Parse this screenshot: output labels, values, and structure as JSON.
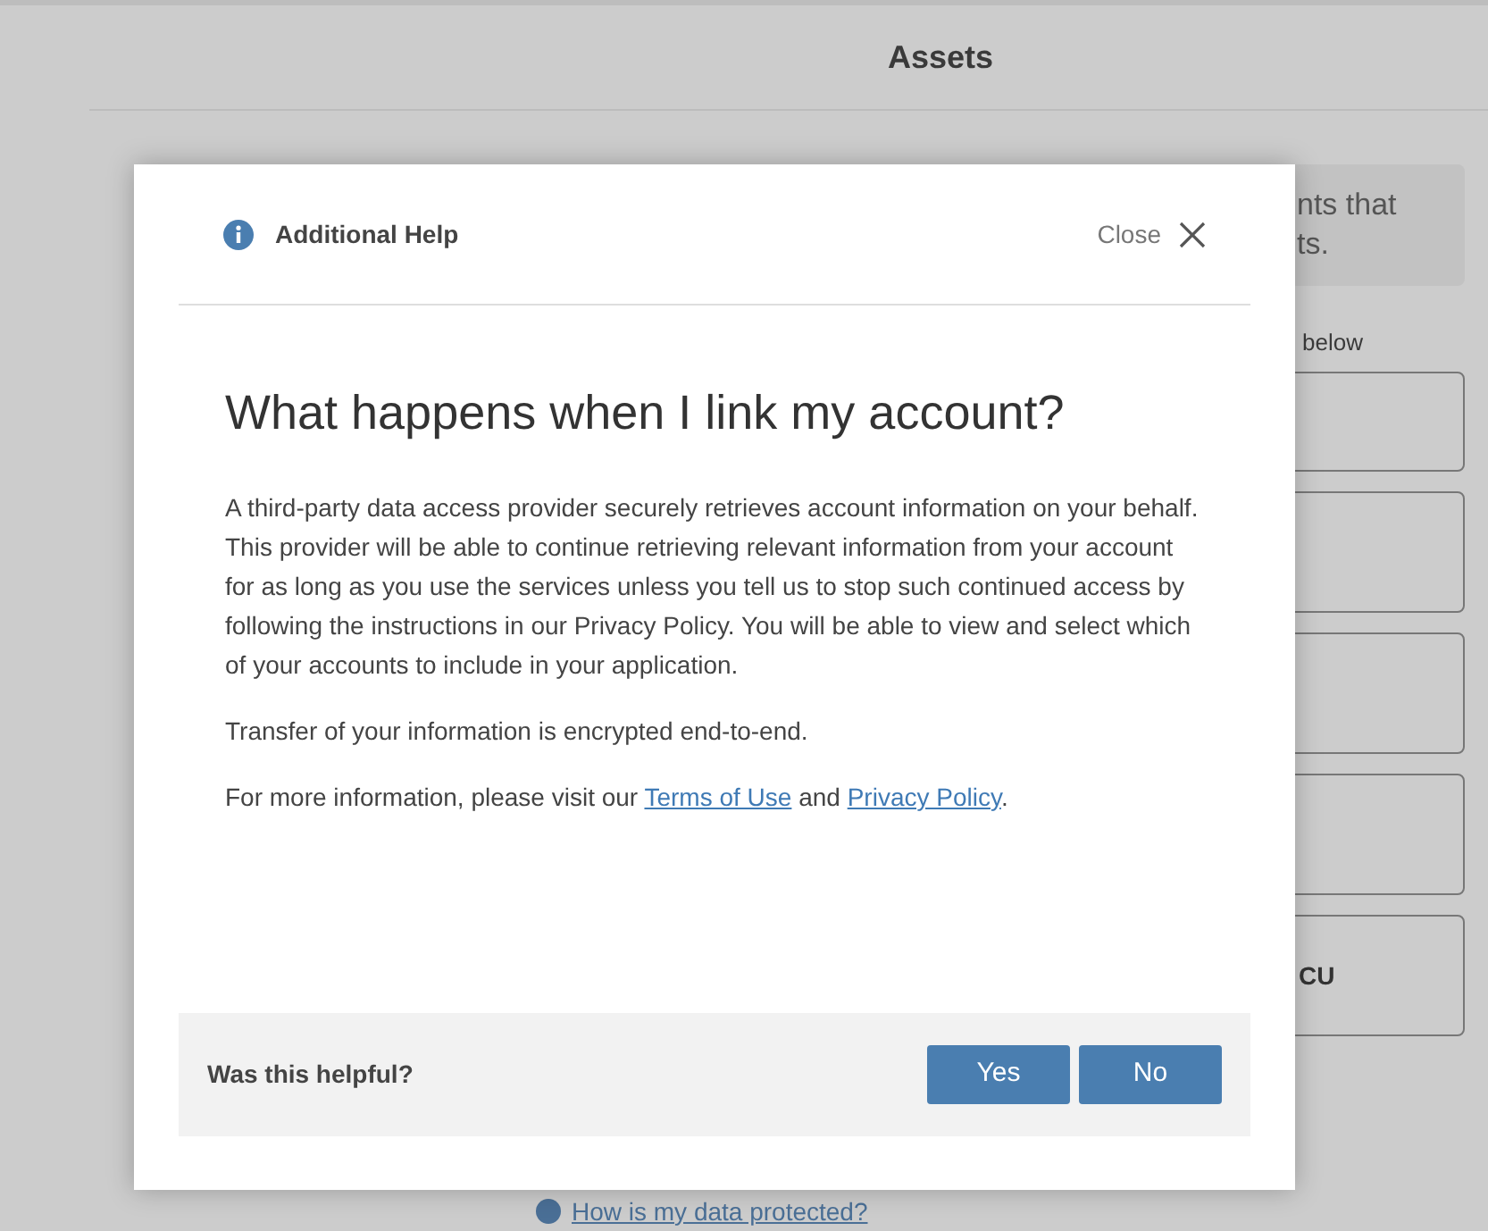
{
  "page": {
    "title": "Assets",
    "notice": [
      "nts that",
      "ts."
    ],
    "field_label": "below",
    "last_card_label": "CU",
    "help_link": "How is my data protected?"
  },
  "dialog": {
    "header": "Additional Help",
    "close": "Close",
    "heading": "What happens when I link my account?",
    "paragraphs": [
      "A third-party data access provider securely retrieves account information on your behalf. This provider will be able to continue retrieving relevant information from your account for as long as you use the services unless you tell us to stop such continued access by following the instructions in our Privacy Policy. You will be able to view and select which of your accounts to include in your application.",
      "Transfer of your information is encrypted end-to-end."
    ],
    "links_sentence": {
      "before": "For more information, please visit our",
      "link_1": "Terms of Use",
      "middle": "and",
      "link_2": "Privacy Policy",
      "after": "."
    },
    "feedback": {
      "question": "Was this helpful?",
      "buttons": [
        "Yes",
        "No"
      ]
    }
  }
}
